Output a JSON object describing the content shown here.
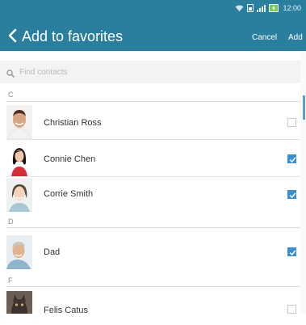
{
  "status_bar": {
    "time": "12:00",
    "icons": [
      "wifi-icon",
      "sim-icon",
      "signal-icon",
      "battery-charging-icon"
    ]
  },
  "header": {
    "title": "Add to favorites",
    "back_icon": "chevron-left-icon",
    "cancel_label": "Cancel",
    "add_label": "Add"
  },
  "search": {
    "placeholder": "Find contacts",
    "value": "",
    "icon": "search-icon"
  },
  "sections": [
    {
      "letter": "C"
    },
    {
      "letter": "D"
    },
    {
      "letter": "F"
    }
  ],
  "contacts": [
    {
      "name": "Christian Ross",
      "checked": false
    },
    {
      "name": "Connie Chen",
      "checked": true
    },
    {
      "name": "Corrie Smith",
      "checked": true
    },
    {
      "name": "Dad",
      "checked": true
    },
    {
      "name": "Felis Catus",
      "checked": false
    }
  ],
  "colors": {
    "header_bg": "#2b7f9e",
    "checkbox_checked": "#3a8fcf",
    "scrollbar": "#5a9ed3"
  }
}
